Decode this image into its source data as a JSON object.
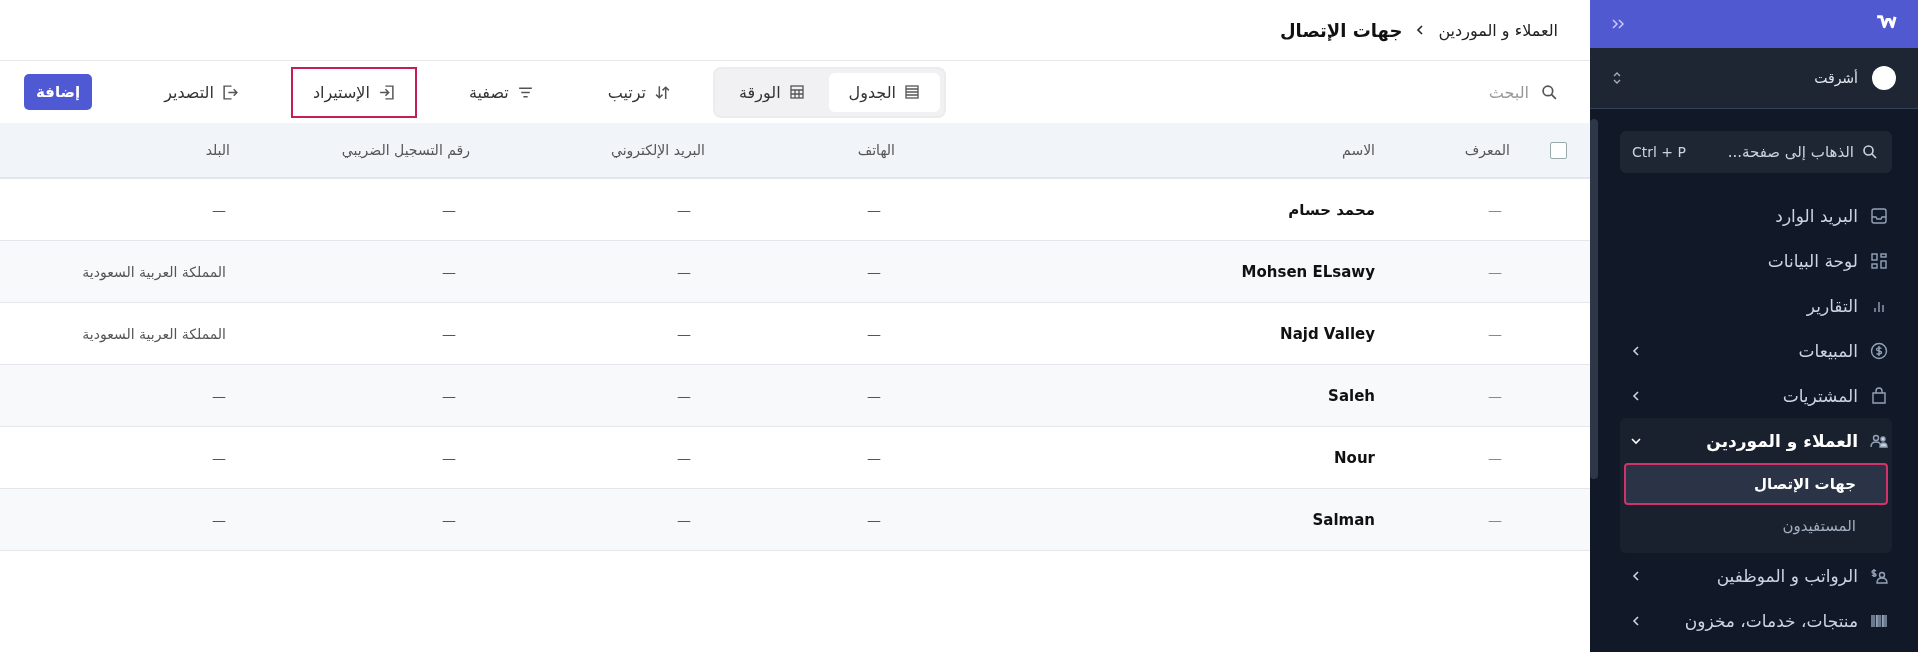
{
  "breadcrumb": {
    "parent": "العملاء و الموردين",
    "current": "جهات الإتصال"
  },
  "toolbar": {
    "search": {
      "placeholder": "البحث"
    },
    "views": [
      {
        "label": "الجدول",
        "kind": "table",
        "selected": true
      },
      {
        "label": "الورقة",
        "kind": "sheet",
        "selected": false
      }
    ],
    "actions": [
      {
        "label": "ترتيب",
        "kind": "sort",
        "highlighted": false
      },
      {
        "label": "تصفية",
        "kind": "filter",
        "highlighted": false
      },
      {
        "label": "الإستيراد",
        "kind": "import",
        "highlighted": true
      },
      {
        "label": "التصدير",
        "kind": "export",
        "highlighted": false
      }
    ],
    "add_button": "إضافة"
  },
  "table": {
    "select_all": {
      "checked": false
    },
    "columns": [
      "المعرف",
      "الاسم",
      "الهاتف",
      "البريد الإلكتروني",
      "رقم التسجيل الضريبي",
      "البلد"
    ],
    "rows": [
      {
        "cells": [
          "—",
          "محمد حسام",
          "—",
          "—",
          "—",
          "—"
        ]
      },
      {
        "cells": [
          "—",
          "Mohsen ELsawy",
          "—",
          "—",
          "—",
          "المملكة العربية السعودية"
        ]
      },
      {
        "cells": [
          "—",
          "Najd Valley",
          "—",
          "—",
          "—",
          "المملكة العربية السعودية"
        ]
      },
      {
        "cells": [
          "—",
          "Saleh",
          "—",
          "—",
          "—",
          "—"
        ]
      },
      {
        "cells": [
          "—",
          "Nour",
          "—",
          "—",
          "—",
          "—"
        ]
      },
      {
        "cells": [
          "—",
          "Salman",
          "—",
          "—",
          "—",
          "—"
        ]
      }
    ]
  },
  "sidebar": {
    "company": {
      "name": "أشرقت"
    },
    "search": {
      "placeholder": "الذهاب إلى صفحة...",
      "shortcut": "Ctrl + P"
    },
    "items": [
      {
        "label": "البريد الوارد",
        "kind": "inbox",
        "expandable": false,
        "expanded": false
      },
      {
        "label": "لوحة البيانات",
        "kind": "grid",
        "expandable": false,
        "expanded": false
      },
      {
        "label": "التقارير",
        "kind": "bars",
        "expandable": false,
        "expanded": false
      },
      {
        "label": "المبيعات",
        "kind": "dollar",
        "expandable": true,
        "expanded": false
      },
      {
        "label": "المشتريات",
        "kind": "bag",
        "expandable": true,
        "expanded": false
      },
      {
        "label": "العملاء و الموردين",
        "kind": "people",
        "expandable": true,
        "expanded": true,
        "children": [
          {
            "label": "جهات الإتصال",
            "selected": true,
            "highlighted": true
          },
          {
            "label": "المستفيدون",
            "selected": false,
            "highlighted": false
          }
        ]
      },
      {
        "label": "الرواتب و الموظفين",
        "kind": "payroll",
        "expandable": true,
        "expanded": false
      },
      {
        "label": "منتجات، خدمات، مخزون",
        "kind": "barcode",
        "expandable": true,
        "expanded": false
      }
    ]
  }
}
